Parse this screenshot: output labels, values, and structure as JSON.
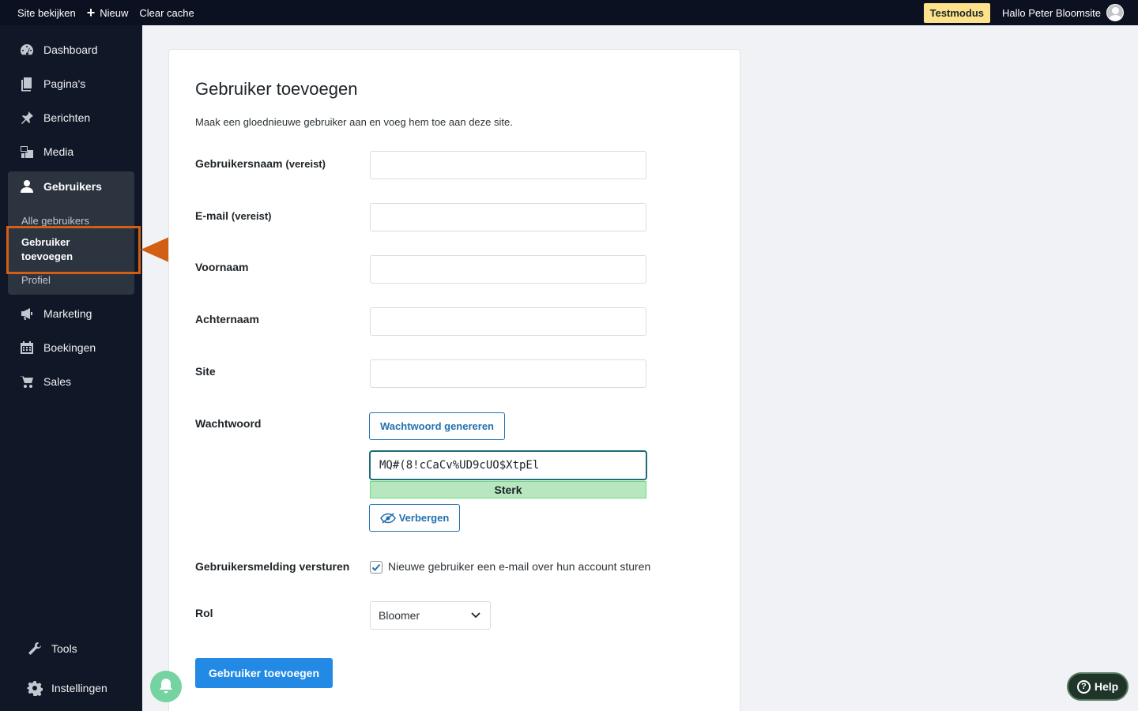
{
  "topbar": {
    "site_view": "Site bekijken",
    "new": "Nieuw",
    "clear_cache": "Clear cache",
    "test_mode": "Testmodus",
    "greeting": "Hallo Peter Bloomsite"
  },
  "sidebar": {
    "items": [
      {
        "label": "Dashboard",
        "icon": "dashboard-icon"
      },
      {
        "label": "Pagina's",
        "icon": "pages-icon"
      },
      {
        "label": "Berichten",
        "icon": "pin-icon"
      },
      {
        "label": "Media",
        "icon": "media-icon"
      },
      {
        "label": "Gebruikers",
        "icon": "user-icon"
      },
      {
        "label": "Marketing",
        "icon": "megaphone-icon"
      },
      {
        "label": "Boekingen",
        "icon": "calendar-icon"
      },
      {
        "label": "Sales",
        "icon": "cart-icon"
      },
      {
        "label": "Tools",
        "icon": "wrench-icon"
      },
      {
        "label": "Instellingen",
        "icon": "gear-icon"
      }
    ],
    "submenu": {
      "all_users": "Alle gebruikers",
      "add_user_line1": "Gebruiker",
      "add_user_line2": "toevoegen",
      "profile": "Profiel"
    }
  },
  "form": {
    "title": "Gebruiker toevoegen",
    "intro": "Maak een gloednieuwe gebruiker aan en voeg hem toe aan deze site.",
    "username_label": "Gebruikersnaam",
    "email_label": "E-mail",
    "required": "(vereist)",
    "firstname_label": "Voornaam",
    "lastname_label": "Achternaam",
    "site_label": "Site",
    "password_label": "Wachtwoord",
    "generate_password": "Wachtwoord genereren",
    "password_value": "MQ#(8!cCaCv%UD9cUO$XtpEl",
    "strength": "Sterk",
    "hide": "Verbergen",
    "notify_label": "Gebruikersmelding versturen",
    "notify_checkbox": "Nieuwe gebruiker een e-mail over hun account sturen",
    "notify_checked": true,
    "role_label": "Rol",
    "role_value": "Bloomer",
    "submit": "Gebruiker toevoegen"
  },
  "widgets": {
    "help": "Help"
  },
  "colors": {
    "accent": "#2271b1",
    "primary_button": "#2289e5",
    "highlight": "#d25f13",
    "test_mode_bg": "#fce28a",
    "sidebar_bg": "#101827"
  }
}
